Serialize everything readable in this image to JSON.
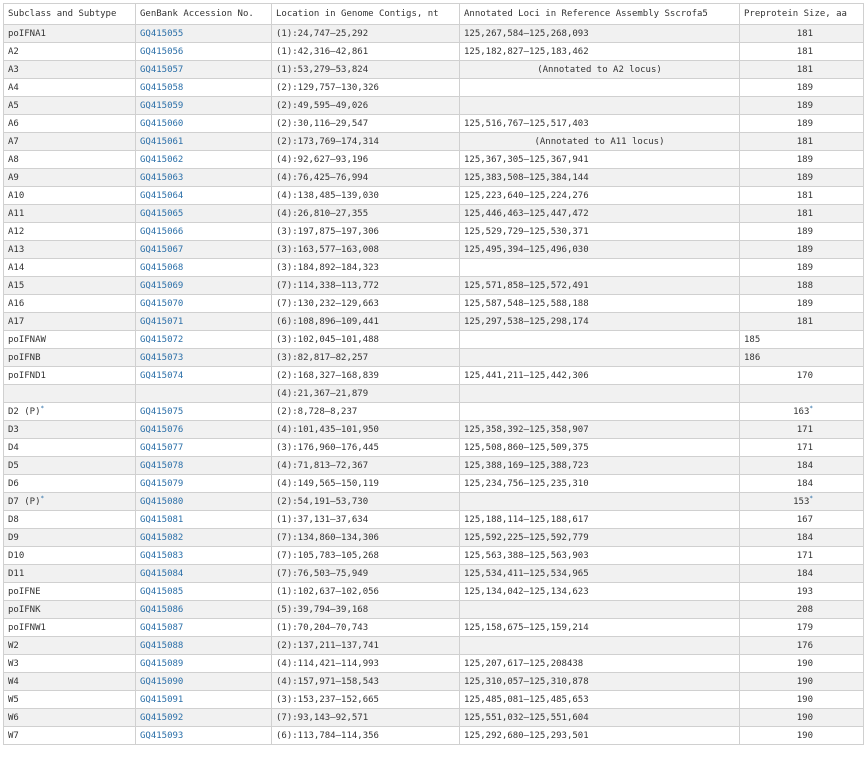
{
  "table": {
    "headers": [
      "Subclass and Subtype",
      "GenBank Accession No.",
      "Location in Genome Contigs, nt",
      "Annotated Loci in Reference Assembly Sscrofa5",
      "Preprotein Size, aa"
    ],
    "rows": [
      {
        "subtype": "poIFNA1",
        "accession": "GQ415055",
        "location": "(1):24,747–25,292",
        "annotated": "125,267,584–125,268,093",
        "size": "181"
      },
      {
        "subtype": "A2",
        "accession": "GQ415056",
        "location": "(1):42,316–42,861",
        "annotated": "125,182,827–125,183,462",
        "size": "181"
      },
      {
        "subtype": "A3",
        "accession": "GQ415057",
        "location": "(1):53,279–53,824",
        "annotated": "(Annotated to A2 locus)",
        "size": "181",
        "annotated_center": true
      },
      {
        "subtype": "A4",
        "accession": "GQ415058",
        "location": "(2):129,757–130,326",
        "annotated": "",
        "size": "189"
      },
      {
        "subtype": "A5",
        "accession": "GQ415059",
        "location": "(2):49,595–49,026",
        "annotated": "",
        "size": "189"
      },
      {
        "subtype": "A6",
        "accession": "GQ415060",
        "location": "(2):30,116–29,547",
        "annotated": "125,516,767–125,517,403",
        "size": "189"
      },
      {
        "subtype": "A7",
        "accession": "GQ415061",
        "location": "(2):173,769–174,314",
        "annotated": "(Annotated to A11 locus)",
        "size": "181",
        "annotated_center": true
      },
      {
        "subtype": "A8",
        "accession": "GQ415062",
        "location": "(4):92,627–93,196",
        "annotated": "125,367,305–125,367,941",
        "size": "189"
      },
      {
        "subtype": "A9",
        "accession": "GQ415063",
        "location": "(4):76,425–76,994",
        "annotated": "125,383,508–125,384,144",
        "size": "189"
      },
      {
        "subtype": "A10",
        "accession": "GQ415064",
        "location": "(4):138,485–139,030",
        "annotated": "125,223,640–125,224,276",
        "size": "181"
      },
      {
        "subtype": "A11",
        "accession": "GQ415065",
        "location": "(4):26,810–27,355",
        "annotated": "125,446,463–125,447,472",
        "size": "181"
      },
      {
        "subtype": "A12",
        "accession": "GQ415066",
        "location": "(3):197,875–197,306",
        "annotated": "125,529,729–125,530,371",
        "size": "189"
      },
      {
        "subtype": "A13",
        "accession": "GQ415067",
        "location": "(3):163,577–163,008",
        "annotated": "125,495,394–125,496,030",
        "size": "189"
      },
      {
        "subtype": "A14",
        "accession": "GQ415068",
        "location": "(3):184,892–184,323",
        "annotated": "",
        "size": "189"
      },
      {
        "subtype": "A15",
        "accession": "GQ415069",
        "location": "(7):114,338–113,772",
        "annotated": "125,571,858–125,572,491",
        "size": "188"
      },
      {
        "subtype": "A16",
        "accession": "GQ415070",
        "location": "(7):130,232–129,663",
        "annotated": "125,587,548–125,588,188",
        "size": "189"
      },
      {
        "subtype": "A17",
        "accession": "GQ415071",
        "location": "(6):108,896–109,441",
        "annotated": "125,297,538–125,298,174",
        "size": "181"
      },
      {
        "subtype": "poIFNAW",
        "accession": "GQ415072",
        "location": "(3):102,045–101,488",
        "annotated": "",
        "size": "185",
        "size_left": true
      },
      {
        "subtype": "poIFNB",
        "accession": "GQ415073",
        "location": "(3):82,817–82,257",
        "annotated": "",
        "size": "186",
        "size_left": true
      },
      {
        "subtype": "poIFND1",
        "accession": "GQ415074",
        "location": "(2):168,327–168,839",
        "annotated": "125,441,211–125,442,306",
        "size": "170"
      },
      {
        "subtype": "",
        "accession": "",
        "location": "(4):21,367–21,879",
        "annotated": "",
        "size": ""
      },
      {
        "subtype": "D2 (P)",
        "subtype_sup": "*",
        "accession": "GQ415075",
        "location": "(2):8,728–8,237",
        "annotated": "",
        "size": "163",
        "size_sup": "*"
      },
      {
        "subtype": "D3",
        "accession": "GQ415076",
        "location": "(4):101,435–101,950",
        "annotated": "125,358,392–125,358,907",
        "size": "171"
      },
      {
        "subtype": "D4",
        "accession": "GQ415077",
        "location": "(3):176,960–176,445",
        "annotated": "125,508,860–125,509,375",
        "size": "171"
      },
      {
        "subtype": "D5",
        "accession": "GQ415078",
        "location": "(4):71,813–72,367",
        "annotated": "125,388,169–125,388,723",
        "size": "184"
      },
      {
        "subtype": "D6",
        "accession": "GQ415079",
        "location": "(4):149,565–150,119",
        "annotated": "125,234,756–125,235,310",
        "size": "184"
      },
      {
        "subtype": "D7 (P)",
        "subtype_sup": "*",
        "accession": "GQ415080",
        "location": "(2):54,191–53,730",
        "annotated": "",
        "size": "153",
        "size_sup": "*"
      },
      {
        "subtype": "D8",
        "accession": "GQ415081",
        "location": "(1):37,131–37,634",
        "annotated": "125,188,114–125,188,617",
        "size": "167"
      },
      {
        "subtype": "D9",
        "accession": "GQ415082",
        "location": "(7):134,860–134,306",
        "annotated": "125,592,225–125,592,779",
        "size": "184"
      },
      {
        "subtype": "D10",
        "accession": "GQ415083",
        "location": "(7):105,783–105,268",
        "annotated": "125,563,388–125,563,903",
        "size": "171"
      },
      {
        "subtype": "D11",
        "accession": "GQ415084",
        "location": "(7):76,503–75,949",
        "annotated": "125,534,411–125,534,965",
        "size": "184"
      },
      {
        "subtype": "poIFNE",
        "accession": "GQ415085",
        "location": "(1):102,637–102,056",
        "annotated": "125,134,042–125,134,623",
        "size": "193"
      },
      {
        "subtype": "poIFNK",
        "accession": "GQ415086",
        "location": "(5):39,794–39,168",
        "annotated": "",
        "size": "208"
      },
      {
        "subtype": "poIFNW1",
        "accession": "GQ415087",
        "location": "(1):70,204–70,743",
        "annotated": "125,158,675–125,159,214",
        "size": "179"
      },
      {
        "subtype": "W2",
        "accession": "GQ415088",
        "location": "(2):137,211–137,741",
        "annotated": "",
        "size": "176"
      },
      {
        "subtype": "W3",
        "accession": "GQ415089",
        "location": "(4):114,421–114,993",
        "annotated": "125,207,617–125,208438",
        "size": "190"
      },
      {
        "subtype": "W4",
        "accession": "GQ415090",
        "location": "(4):157,971–158,543",
        "annotated": "125,310,057–125,310,878",
        "size": "190"
      },
      {
        "subtype": "W5",
        "accession": "GQ415091",
        "location": "(3):153,237–152,665",
        "annotated": "125,485,081–125,485,653",
        "size": "190"
      },
      {
        "subtype": "W6",
        "accession": "GQ415092",
        "location": "(7):93,143–92,571",
        "annotated": "125,551,032–125,551,604",
        "size": "190"
      },
      {
        "subtype": "W7",
        "accession": "GQ415093",
        "location": "(6):113,784–114,356",
        "annotated": "125,292,680–125,293,501",
        "size": "190"
      }
    ]
  }
}
